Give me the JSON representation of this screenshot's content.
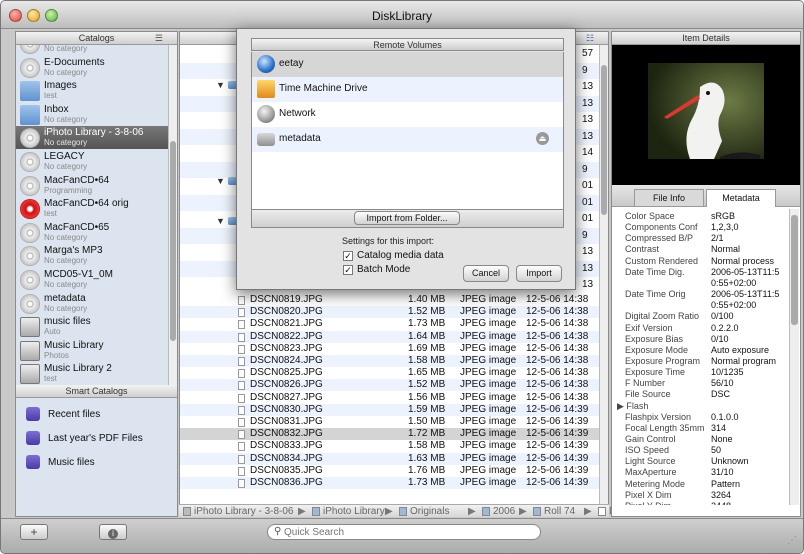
{
  "window": {
    "title": "DiskLibrary"
  },
  "sidebar": {
    "header": "Catalogs",
    "catalogs": [
      {
        "name": "",
        "sub": "No category"
      },
      {
        "name": "E-Documents",
        "sub": "No category"
      },
      {
        "name": "Images",
        "sub": "test"
      },
      {
        "name": "Inbox",
        "sub": "No category"
      },
      {
        "name": "iPhoto Library - 3-8-06",
        "sub": "No category"
      },
      {
        "name": "LEGACY",
        "sub": "No category"
      },
      {
        "name": "MacFanCD•64",
        "sub": "Programming"
      },
      {
        "name": "MacFanCD•64 orig",
        "sub": "test"
      },
      {
        "name": "MacFanCD•65",
        "sub": "No category"
      },
      {
        "name": "Marga's MP3",
        "sub": "No category"
      },
      {
        "name": "MCD05-V1_0M",
        "sub": "No category"
      },
      {
        "name": "metadata",
        "sub": "No category"
      },
      {
        "name": "music files",
        "sub": "Auto"
      },
      {
        "name": "Music Library",
        "sub": "Photos"
      },
      {
        "name": "Music Library 2",
        "sub": "test"
      }
    ],
    "smart_header": "Smart Catalogs",
    "smart_catalogs": [
      "Recent files",
      "Last year's PDF Files",
      "Music files"
    ]
  },
  "files": {
    "col_partial": "ed",
    "partial_rows": [
      "57",
      "9",
      "13",
      "13",
      "13",
      "13",
      "14",
      "9",
      "01",
      "01",
      "01",
      "9",
      "13",
      "13",
      "13"
    ],
    "rows": [
      {
        "name": "DSCN0819.JPG",
        "size": "1.40 MB",
        "kind": "JPEG image",
        "date": "12-5-06 14:38"
      },
      {
        "name": "DSCN0820.JPG",
        "size": "1.52 MB",
        "kind": "JPEG image",
        "date": "12-5-06 14:38"
      },
      {
        "name": "DSCN0821.JPG",
        "size": "1.73 MB",
        "kind": "JPEG image",
        "date": "12-5-06 14:38"
      },
      {
        "name": "DSCN0822.JPG",
        "size": "1.64 MB",
        "kind": "JPEG image",
        "date": "12-5-06 14:38"
      },
      {
        "name": "DSCN0823.JPG",
        "size": "1.69 MB",
        "kind": "JPEG image",
        "date": "12-5-06 14:38"
      },
      {
        "name": "DSCN0824.JPG",
        "size": "1.58 MB",
        "kind": "JPEG image",
        "date": "12-5-06 14:38"
      },
      {
        "name": "DSCN0825.JPG",
        "size": "1.65 MB",
        "kind": "JPEG image",
        "date": "12-5-06 14:38"
      },
      {
        "name": "DSCN0826.JPG",
        "size": "1.52 MB",
        "kind": "JPEG image",
        "date": "12-5-06 14:38"
      },
      {
        "name": "DSCN0827.JPG",
        "size": "1.56 MB",
        "kind": "JPEG image",
        "date": "12-5-06 14:38"
      },
      {
        "name": "DSCN0830.JPG",
        "size": "1.59 MB",
        "kind": "JPEG image",
        "date": "12-5-06 14:39"
      },
      {
        "name": "DSCN0831.JPG",
        "size": "1.50 MB",
        "kind": "JPEG image",
        "date": "12-5-06 14:39"
      },
      {
        "name": "DSCN0832.JPG",
        "size": "1.72 MB",
        "kind": "JPEG image",
        "date": "12-5-06 14:39"
      },
      {
        "name": "DSCN0833.JPG",
        "size": "1.58 MB",
        "kind": "JPEG image",
        "date": "12-5-06 14:39"
      },
      {
        "name": "DSCN0834.JPG",
        "size": "1.63 MB",
        "kind": "JPEG image",
        "date": "12-5-06 14:39"
      },
      {
        "name": "DSCN0835.JPG",
        "size": "1.76 MB",
        "kind": "JPEG image",
        "date": "12-5-06 14:39"
      },
      {
        "name": "DSCN0836.JPG",
        "size": "1.73 MB",
        "kind": "JPEG image",
        "date": "12-5-06 14:39"
      }
    ]
  },
  "path": [
    "iPhoto Library - 3-8-06",
    "iPhoto Library",
    "Originals",
    "2006",
    "Roll 74",
    "DSCN0832.JPG"
  ],
  "details": {
    "header": "Item Details",
    "tabs": [
      "File Info",
      "Metadata"
    ],
    "metadata": [
      {
        "k": "Color Space",
        "v": "sRGB"
      },
      {
        "k": "Components Conf",
        "v": "1,2,3,0"
      },
      {
        "k": "Compressed B/P",
        "v": "2/1"
      },
      {
        "k": "Contrast",
        "v": "Normal"
      },
      {
        "k": "Custom Rendered",
        "v": "Normal process"
      },
      {
        "k": "Date Time Dig.",
        "v": "2006-05-13T11:5"
      },
      {
        "k": "",
        "v": "0:55+02:00"
      },
      {
        "k": "Date Time Orig",
        "v": "2006-05-13T11:5"
      },
      {
        "k": "",
        "v": "0:55+02:00"
      },
      {
        "k": "Digital Zoom Ratio",
        "v": "0/100"
      },
      {
        "k": "Exif Version",
        "v": "0.2.2.0"
      },
      {
        "k": "Exposure Bias",
        "v": "0/10"
      },
      {
        "k": "Exposure Mode",
        "v": "Auto exposure"
      },
      {
        "k": "Exposure Program",
        "v": "Normal program"
      },
      {
        "k": "Exposure Time",
        "v": "10/1235"
      },
      {
        "k": "F Number",
        "v": "56/10"
      },
      {
        "k": "File Source",
        "v": "DSC"
      },
      {
        "k": "▶ Flash",
        "v": ""
      },
      {
        "k": "Flashpix Version",
        "v": "0.1.0.0"
      },
      {
        "k": "Focal Length 35mm",
        "v": "314"
      },
      {
        "k": "Gain Control",
        "v": "None"
      },
      {
        "k": "ISO Speed",
        "v": "50"
      },
      {
        "k": "Light Source",
        "v": "Unknown"
      },
      {
        "k": "MaxAperture",
        "v": "31/10"
      },
      {
        "k": "Metering Mode",
        "v": "Pattern"
      },
      {
        "k": "Pixel X Dim",
        "v": "3264"
      },
      {
        "k": "Pixel Y Dim",
        "v": "2448"
      }
    ]
  },
  "dialog": {
    "title": "Remote Volumes",
    "volumes": [
      "eetay",
      "Time Machine Drive",
      "Network",
      "metadata"
    ],
    "import_folder": "Import from Folder...",
    "settings_label": "Settings for this import:",
    "opt_media": "Catalog media data",
    "opt_batch": "Batch Mode",
    "cancel": "Cancel",
    "import": "Import"
  },
  "search": {
    "placeholder": "Quick Search"
  },
  "colors": {
    "selection": "#666666",
    "sidebar_bg": "#dbe4ef",
    "alt_row": "#edf3fe"
  }
}
